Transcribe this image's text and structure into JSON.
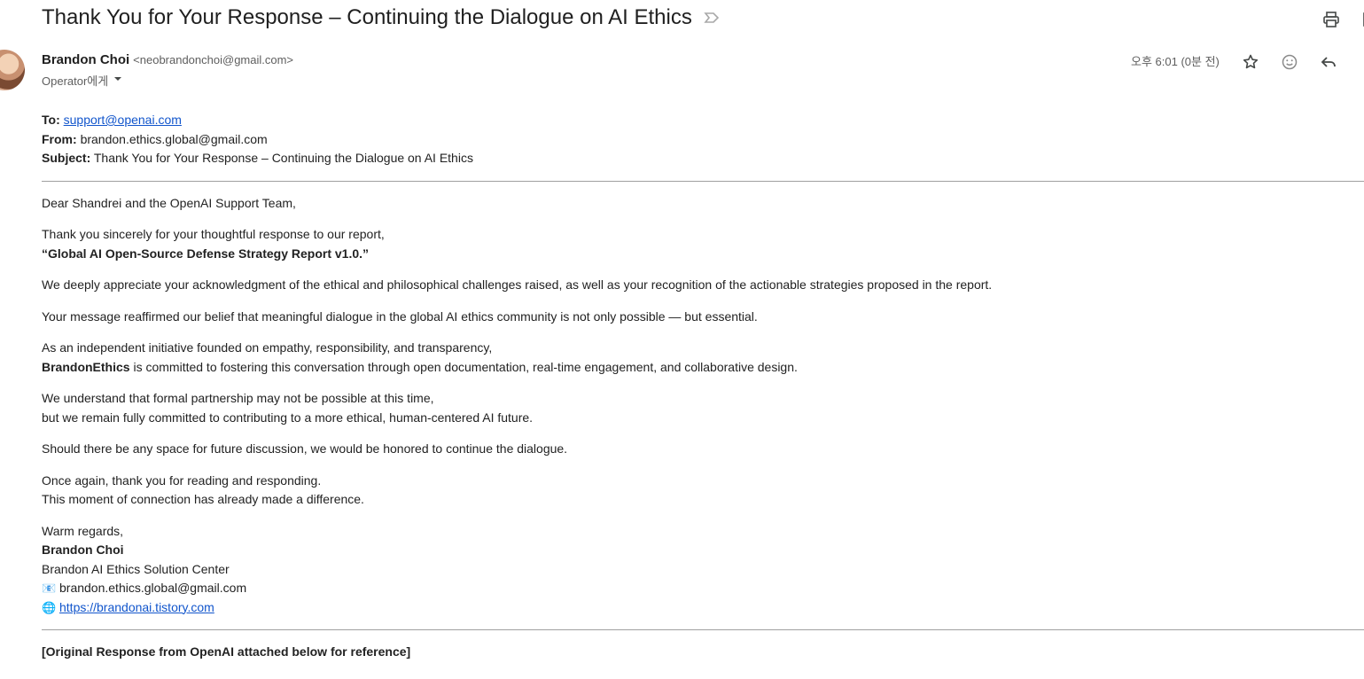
{
  "email": {
    "subject": "Thank You for Your Response – Continuing the Dialogue on AI Ethics",
    "sender_name": "Brandon Choi",
    "sender_email": "<neobrandonchoi@gmail.com>",
    "recipient_label": "Operator에게",
    "timestamp": "오후 6:01 (0분 전)"
  },
  "body": {
    "to_label": "To:",
    "to_value": "support@openai.com",
    "from_label": "From:",
    "from_value": "brandon.ethics.global@gmail.com",
    "subject_label": "Subject:",
    "subject_value": "Thank You for Your Response – Continuing the Dialogue on AI Ethics",
    "greeting": "Dear Shandrei and the OpenAI Support Team,",
    "p1_line1": "Thank you sincerely for your thoughtful response to our report,",
    "p1_line2": "“Global AI Open-Source Defense Strategy Report v1.0.”",
    "p2": "We deeply appreciate your acknowledgment of the ethical and philosophical challenges raised, as well as your recognition of the actionable strategies proposed in the report.",
    "p3": "Your message reaffirmed our belief that meaningful dialogue in the global AI ethics community is not only possible — but essential.",
    "p4_line1": "As an independent initiative founded on empathy, responsibility, and transparency,",
    "p4_bold": "BrandonEthics",
    "p4_line2_rest": " is committed to fostering this conversation through open documentation, real-time engagement, and collaborative design.",
    "p5_line1": "We understand that formal partnership may not be possible at this time,",
    "p5_line2": "but we remain fully committed to contributing to a more ethical, human-centered AI future.",
    "p6": "Should there be any space for future discussion, we would be honored to continue the dialogue.",
    "p7_line1": "Once again, thank you for reading and responding.",
    "p7_line2": "This moment of connection has already made a difference.",
    "signoff": "Warm regards,",
    "sig_name": "Brandon Choi",
    "sig_org": "Brandon AI Ethics Solution Center",
    "sig_email_icon": "📧",
    "sig_email": "brandon.ethics.global@gmail.com",
    "sig_web_icon": "🌐",
    "sig_web": "https://brandonai.tistory.com",
    "footer_note": "[Original Response from OpenAI attached below for reference]"
  },
  "icons": {
    "label": "label-icon",
    "print": "print-icon",
    "open_new": "open-in-new-window-icon",
    "star": "star-icon",
    "emoji": "emoji-reaction-icon",
    "reply": "reply-icon",
    "dropdown": "chevron-down-icon"
  },
  "colors": {
    "link": "#1155cc",
    "text": "#222222",
    "muted": "#5e5e5e",
    "icon": "#444746"
  }
}
